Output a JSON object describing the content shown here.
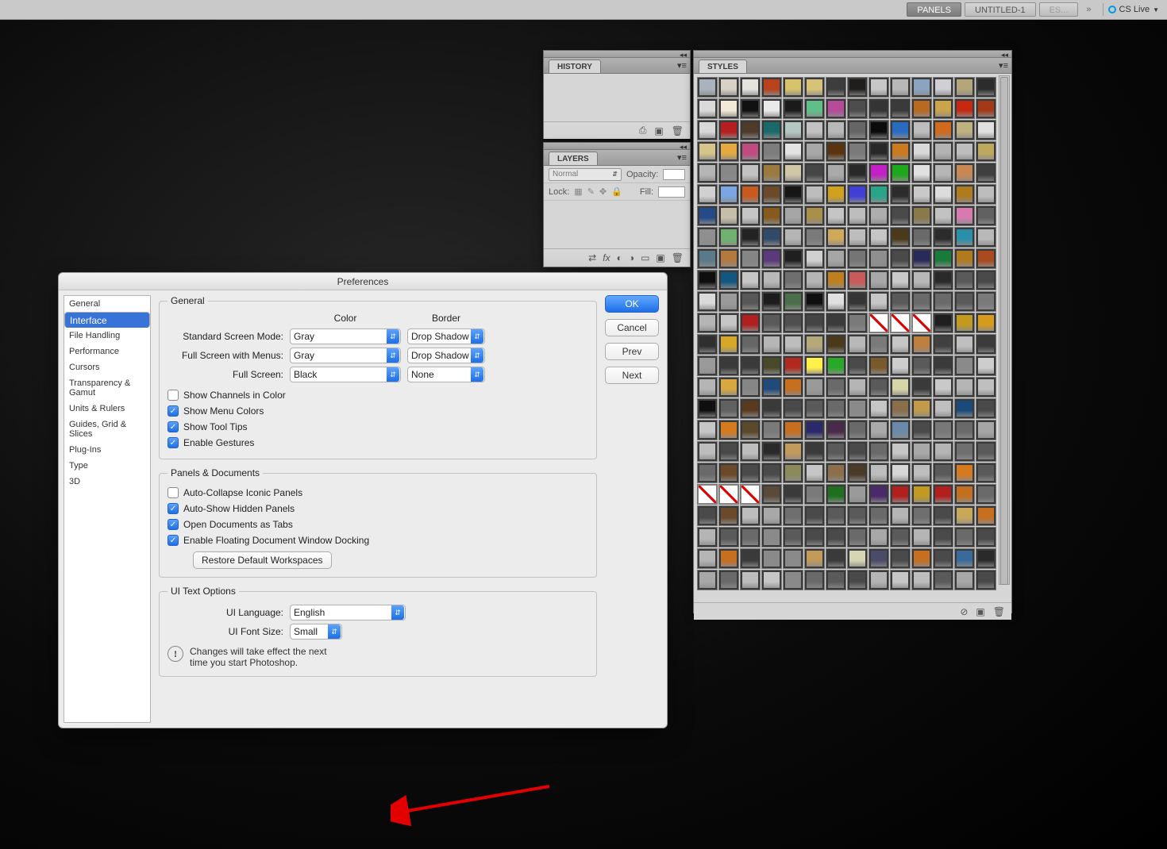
{
  "topbar": {
    "workspaces": [
      "PANELS",
      "UNTITLED-1",
      "ES..."
    ],
    "active_index": 0,
    "cslive": "CS Live"
  },
  "panels": {
    "history": {
      "title": "HISTORY"
    },
    "layers": {
      "title": "LAYERS",
      "blend_mode": "Normal",
      "opacity_label": "Opacity:",
      "lock_label": "Lock:",
      "fill_label": "Fill:"
    },
    "styles": {
      "title": "STYLES"
    }
  },
  "prefs": {
    "title": "Preferences",
    "categories": [
      "General",
      "Interface",
      "File Handling",
      "Performance",
      "Cursors",
      "Transparency & Gamut",
      "Units & Rulers",
      "Guides, Grid & Slices",
      "Plug-Ins",
      "Type",
      "3D"
    ],
    "selected_category_index": 1,
    "buttons": {
      "ok": "OK",
      "cancel": "Cancel",
      "prev": "Prev",
      "next": "Next"
    },
    "general": {
      "legend": "General",
      "header_color": "Color",
      "header_border": "Border",
      "rows": [
        {
          "label": "Standard Screen Mode:",
          "color": "Gray",
          "border": "Drop Shadow"
        },
        {
          "label": "Full Screen with Menus:",
          "color": "Gray",
          "border": "Drop Shadow"
        },
        {
          "label": "Full Screen:",
          "color": "Black",
          "border": "None"
        }
      ],
      "checks": [
        {
          "label": "Show Channels in Color",
          "on": false
        },
        {
          "label": "Show Menu Colors",
          "on": true
        },
        {
          "label": "Show Tool Tips",
          "on": true
        },
        {
          "label": "Enable Gestures",
          "on": true
        }
      ]
    },
    "panels_docs": {
      "legend": "Panels & Documents",
      "checks": [
        {
          "label": "Auto-Collapse Iconic Panels",
          "on": false
        },
        {
          "label": "Auto-Show Hidden Panels",
          "on": true
        },
        {
          "label": "Open Documents as Tabs",
          "on": true
        },
        {
          "label": "Enable Floating Document Window Docking",
          "on": true
        }
      ],
      "restore": "Restore Default Workspaces"
    },
    "ui_text": {
      "legend": "UI Text Options",
      "language_label": "UI Language:",
      "language": "English",
      "fontsize_label": "UI Font Size:",
      "fontsize": "Small",
      "note1": "Changes will take effect the next",
      "note2": "time you start Photoshop."
    }
  },
  "style_swatches": [
    "#a9b2bd",
    "#d8d1c6",
    "#e5e3de",
    "#b9421f",
    "#d6c36a",
    "#d7c377",
    "#3d3d3d",
    "#1f1e1c",
    "#c7c7c7",
    "#b8b8b8",
    "#8aa4c1",
    "#cfcfd4",
    "#b4a67a",
    "#2c2c2c",
    "#dadada",
    "#f2ead6",
    "#111111",
    "#eaeaea",
    "#1a1a1a",
    "#5fbf88",
    "#b64a9b",
    "#4d4d4d",
    "#343434",
    "#3a3a3a",
    "#b96a1f",
    "#caa34a",
    "#c7280f",
    "#a23917",
    "#d8d8d8",
    "#b61f1f",
    "#4e3b2a",
    "#1b6a6b",
    "#b5c7c2",
    "#c2c2c2",
    "#b8b8b8",
    "#666666",
    "#0b0b0b",
    "#2a6bc2",
    "#bdbdbd",
    "#cf6a1f",
    "#bfb27e",
    "#e0e0e0",
    "#d5c58a",
    "#e5a942",
    "#c14a7e",
    "#7d7d7d",
    "#e3e3e3",
    "#a8a8a8",
    "#5a330f",
    "#7a7a7a",
    "#282828",
    "#cc7a1f",
    "#d9d9d9",
    "#b3b3b3",
    "#bdbdbd",
    "#bda85e",
    "#b5b5b5",
    "#888888",
    "#c2c2c2",
    "#9a7a3f",
    "#d0c6a8",
    "#464646",
    "#aaaaaa",
    "#292929",
    "#c520c5",
    "#1ea81e",
    "#e0e0e0",
    "#b6b6b6",
    "#c88854",
    "#3f3f3f",
    "#d0d0d0",
    "#7aa6e2",
    "#c85a1f",
    "#6b4a2a",
    "#161616",
    "#bdbdbd",
    "#cfa11f",
    "#4040d6",
    "#29a489",
    "#2c2c2c",
    "#c9c9c9",
    "#dcdcdc",
    "#b07a1f",
    "#bdbdbd",
    "#254a89",
    "#c6bfa8",
    "#c6c6c6",
    "#855a1f",
    "#a6a6a6",
    "#a88f4a",
    "#c5c5c5",
    "#bdbdbd",
    "#adadad",
    "#4a4a4a",
    "#8a7a4a",
    "#c2c2c2",
    "#d67ab0",
    "#616161",
    "#8f8f8f",
    "#6fb26f",
    "#232323",
    "#324a6a",
    "#b5b5b5",
    "#7a7a7a",
    "#cfa85a",
    "#bdbdbd",
    "#c6c6c6",
    "#4a3a1a",
    "#6a6a6a",
    "#2b2b2b",
    "#2a8fa8",
    "#b8b8b8",
    "#5a7a8a",
    "#b27a3f",
    "#858585",
    "#5a3a7a",
    "#1f1f1f",
    "#d1d1d1",
    "#a6a6a6",
    "#757575",
    "#8f8f8f",
    "#4a4a4a",
    "#2a2a5a",
    "#1a7a3a",
    "#b07a1f",
    "#aa4a1f",
    "#0e0e0e",
    "#135680",
    "#c6c6c6",
    "#b8b8b8",
    "#6f6f6f",
    "#b5b5b5",
    "#bf7f1f",
    "#c85a5a",
    "#a8a8a8",
    "#c9c9c9",
    "#b8b8b8",
    "#2a2a2a",
    "#5a5a5a",
    "#4a4a4a",
    "#dadada",
    "#9a9a9a",
    "#585858",
    "#1c1c1c",
    "#4a6f4a",
    "#0f0f0f",
    "#e0e0e0",
    "#353535",
    "#c6c6c6",
    "#5a5a5a",
    "#6a6a6a",
    "#6a6a6a",
    "#5a5a5a",
    "#7a7a7a",
    "#b5b5b5",
    "#c6c6c6",
    "#b21f1f",
    "#5a5a5a",
    "#4f4f4f",
    "#444444",
    "#3b3b3b",
    "#7a7a7a",
    "none",
    "none",
    "none",
    "#1f1f1f",
    "#c29a1f",
    "#d69a1f",
    "#2f2f2f",
    "#d6a82a",
    "#666666",
    "#b6b6b6",
    "#bdbdbd",
    "#b5a87a",
    "#4a3a1a",
    "#b8b8b8",
    "#7a7a7a",
    "#c6c6c6",
    "#bf7f3f",
    "#404040",
    "#bfbfbf",
    "#3b3b3b",
    "#9a9a9a",
    "#3a3a3a",
    "#3a3a3a",
    "#4a4a2a",
    "#b22a1f",
    "#fff04a",
    "#2aa82a",
    "#4a4a4a",
    "#7a5a2a",
    "#cdcdcd",
    "#5a5a5a",
    "#3a3a3a",
    "#8a8a8a",
    "#cdcdcd",
    "#b5b5b5",
    "#d6a83f",
    "#868686",
    "#1f4a7a",
    "#c66f1f",
    "#9a9a9a",
    "#6a6a6a",
    "#b5b5b5",
    "#5a5a5a",
    "#d6d6a8",
    "#3a3a3a",
    "#c9c9c9",
    "#b5b5b5",
    "#bfbfbf",
    "#0f0f0f",
    "#616161",
    "#5a3a1f",
    "#3a3a3a",
    "#4a4a4a",
    "#5a5a5a",
    "#6a6a6a",
    "#8a8a8a",
    "#c6c6c6",
    "#8a6f4a",
    "#c29a4a",
    "#bfbfbf",
    "#1a4a7a",
    "#4a4a4a",
    "#c6c6c6",
    "#d67a1f",
    "#5a4a2a",
    "#7a7a7a",
    "#c66f1f",
    "#2a2a6a",
    "#4a2a4a",
    "#6a6a6a",
    "#aaaaaa",
    "#6a8aa8",
    "#4a4a4a",
    "#787878",
    "#6a6a6a",
    "#a6a6a6",
    "#bdbdbd",
    "#4a4a4a",
    "#bdbdbd",
    "#2a2a2a",
    "#c29a5a",
    "#3a3a3a",
    "#5a5a5a",
    "#4a4a4a",
    "#6a6a6a",
    "#c6c6c6",
    "#a8a8a8",
    "#b5b5b5",
    "#6f6f6f",
    "#5a5a5a",
    "#6a6a6a",
    "#6a4a2a",
    "#4a4a4a",
    "#4a4a4a",
    "#8a8a5a",
    "#c6c6c6",
    "#8a6f4a",
    "#4a3a2a",
    "#bdbdbd",
    "#d6d6d6",
    "#bdbdbd",
    "#5a5a5a",
    "#d67a1f",
    "#5a5a5a",
    "none",
    "none",
    "none",
    "#5a4a3a",
    "#3a3a3a",
    "#7a7a7a",
    "#1f6f1f",
    "#9a9a9a",
    "#4a2a6a",
    "#b21f1f",
    "#c29a1f",
    "#b21f1f",
    "#c26f1f",
    "#6a6a6a",
    "#4a4a4a",
    "#6a4a2a",
    "#bdbdbd",
    "#a8a8a8",
    "#6f6f6f",
    "#4a4a4a",
    "#5a5a5a",
    "#5a5a5a",
    "#6a6a6a",
    "#b5b5b5",
    "#6f6f6f",
    "#4a4a4a",
    "#c9a85a",
    "#c66f1f",
    "#b5b5b5",
    "#5a5a5a",
    "#6a6a6a",
    "#8a8a8a",
    "#5a5a5a",
    "#4a4a4a",
    "#4a4a4a",
    "#6a6a6a",
    "#a8a8a8",
    "#5a5a5a",
    "#b5b5b5",
    "#4a4a4a",
    "#6a6a6a",
    "#4a4a4a",
    "#b5b5b5",
    "#c66f1f",
    "#3a3a3a",
    "#8a8a8a",
    "#8a8a8a",
    "#c29a5a",
    "#3a3a3a",
    "#d6d6b5",
    "#4a4a6a",
    "#4a4a4a",
    "#c66f1f",
    "#4a4a4a",
    "#3a6a9a",
    "#2a2a2a",
    "#a8a8a8",
    "#6a6a6a",
    "#bdbdbd",
    "#c6c6c6",
    "#8a8a8a",
    "#6a6a6a",
    "#5a5a5a",
    "#4a4a4a",
    "#b5b5b5",
    "#c6c6c6",
    "#bdbdbd",
    "#5a5a5a",
    "#a8a8a8",
    "#4a4a4a"
  ]
}
